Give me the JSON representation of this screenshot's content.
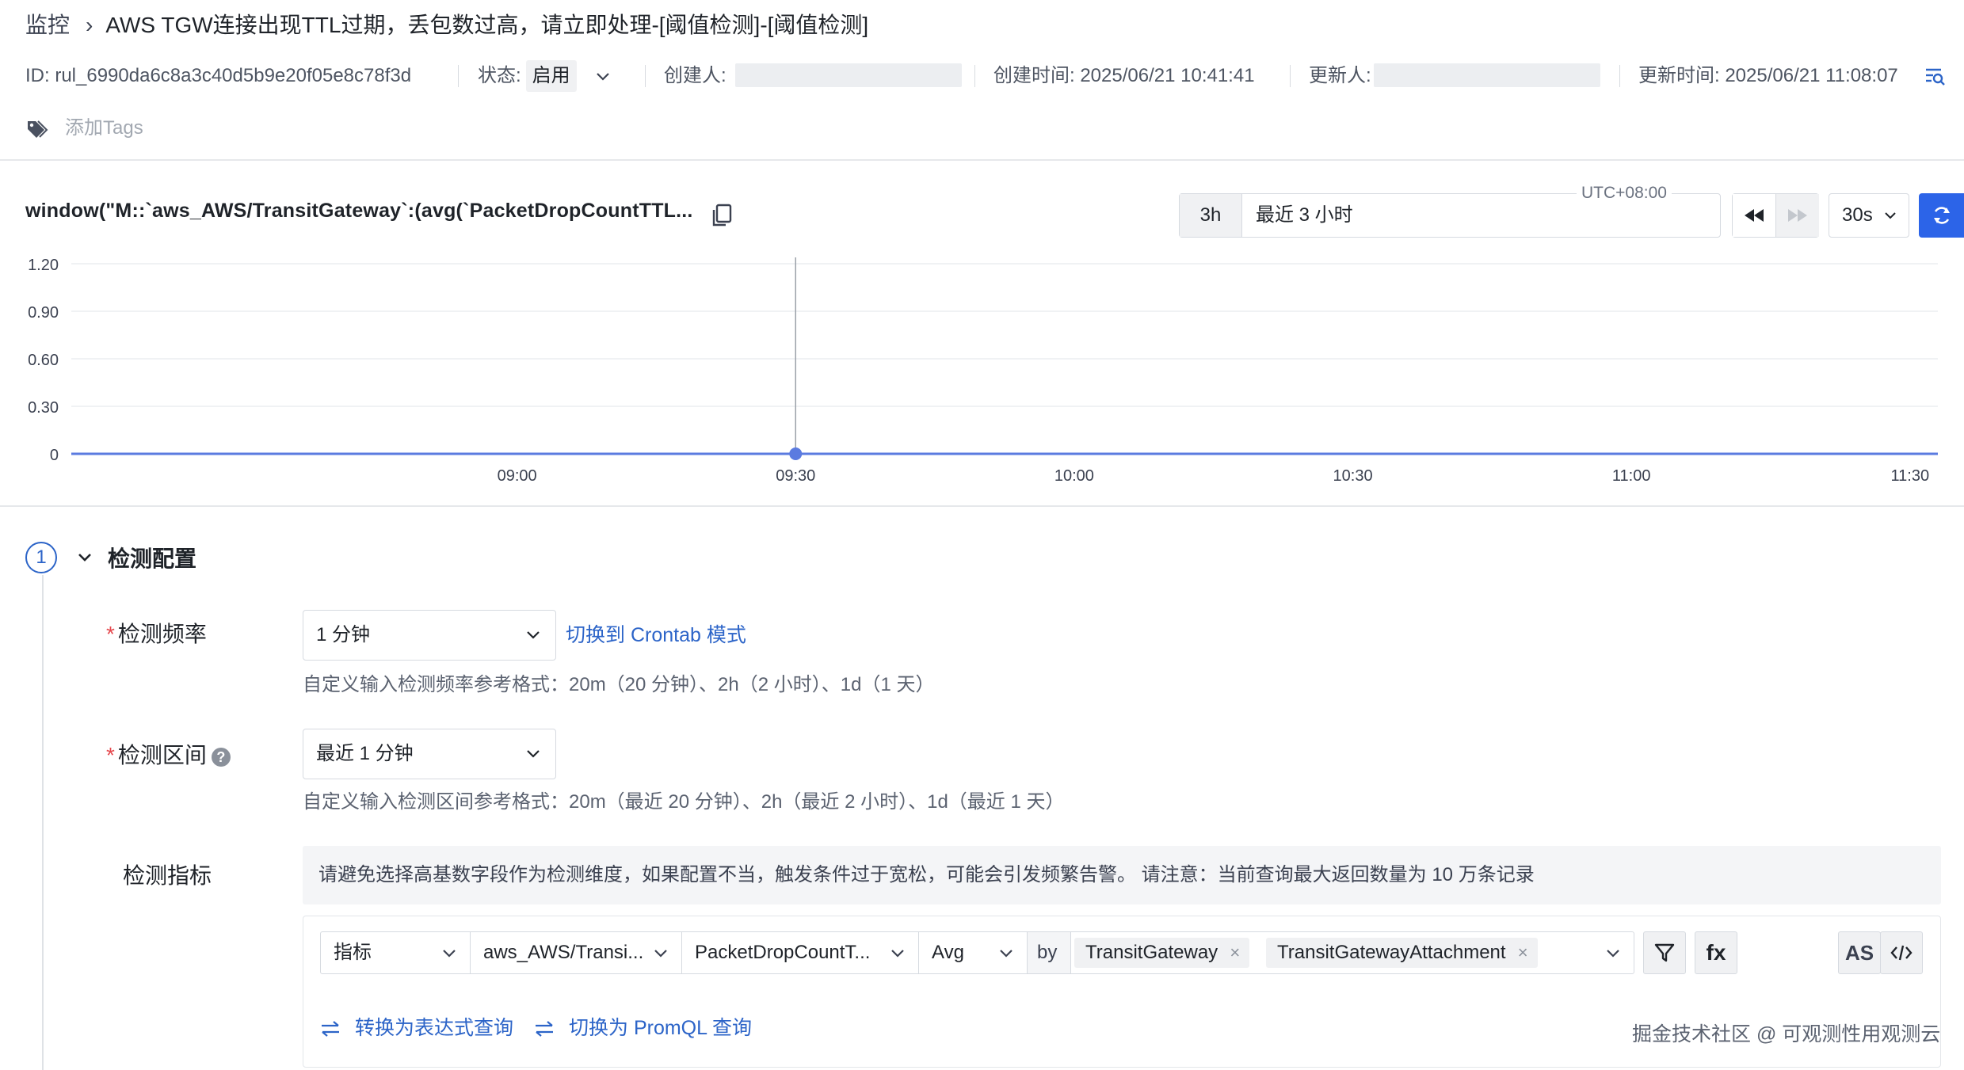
{
  "breadcrumb": {
    "root": "监控",
    "separator": "›",
    "title": "AWS TGW连接出现TTL过期，丢包数过高，请立即处理-[阈值检测]-[阈值检测]"
  },
  "meta": {
    "id_label": "ID: rul_6990da6c8a3c40d5b9e20f05e8c78f3d",
    "status_label": "状态:",
    "status_value": "启用",
    "creator_label": "创建人:",
    "created_time": "创建时间: 2025/06/21 10:41:41",
    "updater_label": "更新人:",
    "updated_time": "更新时间: 2025/06/21 11:08:07"
  },
  "tags": {
    "placeholder": "添加Tags"
  },
  "query": {
    "title": "window(\"M::`aws_AWS/TransitGateway`:(avg(`PacketDropCountTTL...",
    "timezone": "UTC+08:00",
    "range_short": "3h",
    "range_label": "最近 3 小时",
    "refresh_interval": "30s"
  },
  "chart_data": {
    "type": "line",
    "y_ticks": [
      "1.20",
      "0.90",
      "0.60",
      "0.30",
      "0"
    ],
    "ylim": [
      0,
      1.2
    ],
    "x_ticks": [
      "09:00",
      "09:30",
      "10:00",
      "10:30",
      "11:00",
      "11:30"
    ],
    "x_range": [
      "08:12",
      "11:33"
    ],
    "series": [
      {
        "x": [
          "08:12",
          "09:30",
          "11:33"
        ],
        "values": [
          0,
          0,
          0
        ]
      }
    ],
    "marker": "09:30",
    "line_color": "#5b7be0",
    "grid": true
  },
  "detect": {
    "step": "1",
    "title": "检测配置",
    "freq_label": "检测频率",
    "freq_value": "1 分钟",
    "freq_link": "切换到 Crontab 模式",
    "freq_hint": "自定义输入检测频率参考格式：20m（20 分钟）、2h（2 小时）、1d（1 天）",
    "range_label": "检测区间",
    "range_value": "最近 1 分钟",
    "range_hint": "自定义输入检测区间参考格式：20m（最近 20 分钟）、2h（最近 2 小时）、1d（最近 1 天）",
    "metric_label": "检测指标",
    "notice": "请避免选择高基数字段作为检测维度，如果配置不当，触发条件过于宽松，可能会引发频繁告警。 请注意：当前查询最大返回数量为 10 万条记录",
    "q_type": "指标",
    "q_namespace": "aws_AWS/Transi...",
    "q_metric": "PacketDropCountT...",
    "q_agg": "Avg",
    "q_by": "by",
    "q_tags": [
      "TransitGateway",
      "TransitGatewayAttachment"
    ],
    "fx_label": "fx",
    "as_label": "AS",
    "convert_expr": "转换为表达式查询",
    "convert_promql": "切换为 PromQL 查询"
  },
  "watermark": "掘金技术社区 @ 可观测性用观测云"
}
